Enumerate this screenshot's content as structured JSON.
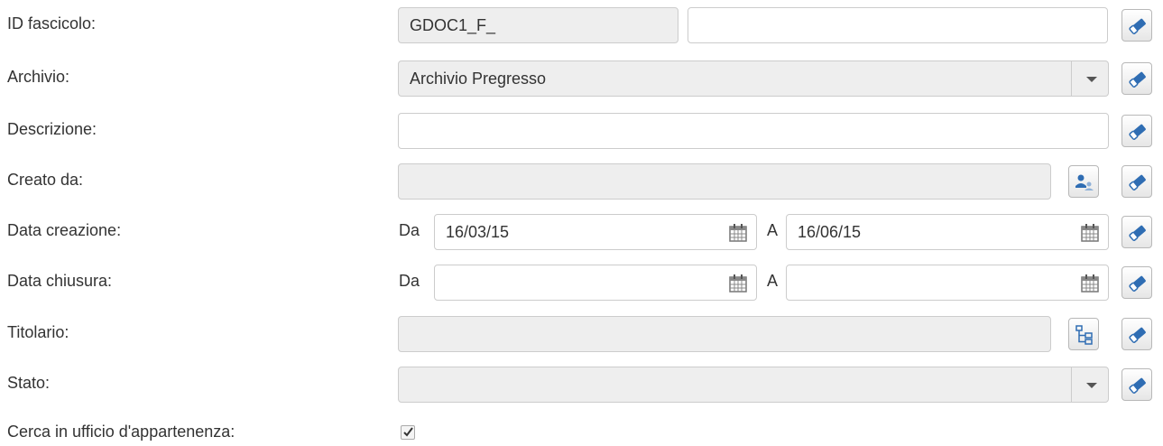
{
  "form": {
    "id_fascicolo": {
      "label": "ID fascicolo:",
      "prefix": "GDOC1_F_",
      "value": ""
    },
    "archivio": {
      "label": "Archivio:",
      "selected": "Archivio Pregresso"
    },
    "descrizione": {
      "label": "Descrizione:",
      "value": ""
    },
    "creato_da": {
      "label": "Creato da:",
      "value": ""
    },
    "data_creazione": {
      "label": "Data creazione:",
      "from_label": "Da",
      "from_value": "16/03/15",
      "to_label": "A",
      "to_value": "16/06/15"
    },
    "data_chiusura": {
      "label": "Data chiusura:",
      "from_label": "Da",
      "from_value": "",
      "to_label": "A",
      "to_value": ""
    },
    "titolario": {
      "label": "Titolario:",
      "value": ""
    },
    "stato": {
      "label": "Stato:",
      "selected": ""
    },
    "cerca_ufficio": {
      "label": "Cerca in ufficio d'appartenenza:",
      "checked": true
    }
  },
  "icons": {
    "clear": "eraser-icon",
    "calendar": "calendar-icon",
    "user_picker": "user-picker-icon",
    "tree": "tree-icon",
    "dropdown": "chevron-down-icon",
    "check": "checkmark-icon"
  },
  "colors": {
    "icon_blue": "#2f6db3",
    "readonly_bg": "#eeeeee",
    "border": "#cccccc",
    "text": "#333333"
  }
}
